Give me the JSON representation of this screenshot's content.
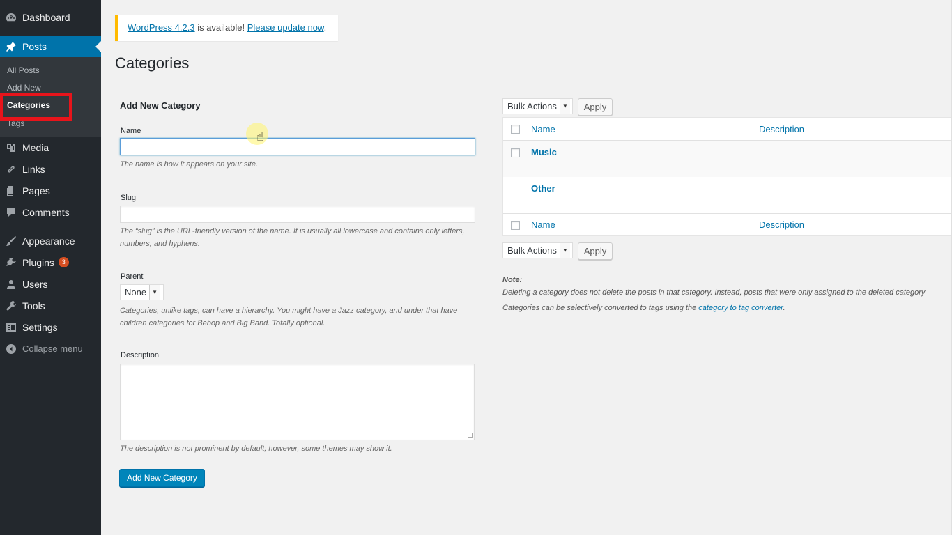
{
  "sidebar": {
    "dashboard": "Dashboard",
    "posts": "Posts",
    "submenu": {
      "all_posts": "All Posts",
      "add_new": "Add New",
      "categories": "Categories",
      "tags": "Tags"
    },
    "media": "Media",
    "links": "Links",
    "pages": "Pages",
    "comments": "Comments",
    "appearance": "Appearance",
    "plugins": "Plugins",
    "plugins_badge": "3",
    "users": "Users",
    "tools": "Tools",
    "settings": "Settings",
    "collapse": "Collapse menu"
  },
  "notice": {
    "version_link": "WordPress 4.2.3",
    "middle": " is available! ",
    "update_link": "Please update now",
    "end": "."
  },
  "page_title": "Categories",
  "form": {
    "heading": "Add New Category",
    "name_label": "Name",
    "name_value": "",
    "name_help": "The name is how it appears on your site.",
    "slug_label": "Slug",
    "slug_value": "",
    "slug_help_1": "The “slug” is the URL-friendly version of the name. It is usually all lowercase and contains only letters,",
    "slug_help_2": "numbers, and hyphens.",
    "parent_label": "Parent",
    "parent_value": "None",
    "parent_help_1": "Categories, unlike tags, can have a hierarchy. You might have a Jazz category, and under that have",
    "parent_help_2": "children categories for Bebop and Big Band. Totally optional.",
    "description_label": "Description",
    "description_help": "The description is not prominent by default; however, some themes may show it.",
    "submit": "Add New Category"
  },
  "list": {
    "bulk_actions": "Bulk Actions",
    "apply": "Apply",
    "col_name": "Name",
    "col_description": "Description",
    "rows": [
      {
        "name": "Music",
        "description": ""
      },
      {
        "name": "Other",
        "description": ""
      }
    ]
  },
  "note": {
    "title": "Note:",
    "line1": "Deleting a category does not delete the posts in that category. Instead, posts that were only assigned to the deleted category",
    "line2_prefix": "Categories can be selectively converted to tags using the ",
    "line2_link": "category to tag converter",
    "line2_suffix": "."
  },
  "colors": {
    "sidebar_bg": "#23282d",
    "active_menu": "#0073aa",
    "link": "#0073aa",
    "notice_border": "#ffba00",
    "highlight_box": "#e8141b",
    "badge": "#d54e21"
  },
  "icons": [
    "dashboard-icon",
    "pin-icon",
    "media-icon",
    "link-icon",
    "pages-icon",
    "comment-icon",
    "brush-icon",
    "plugin-icon",
    "user-icon",
    "wrench-icon",
    "settings-icon",
    "collapse-icon",
    "hand-pointer-icon"
  ]
}
